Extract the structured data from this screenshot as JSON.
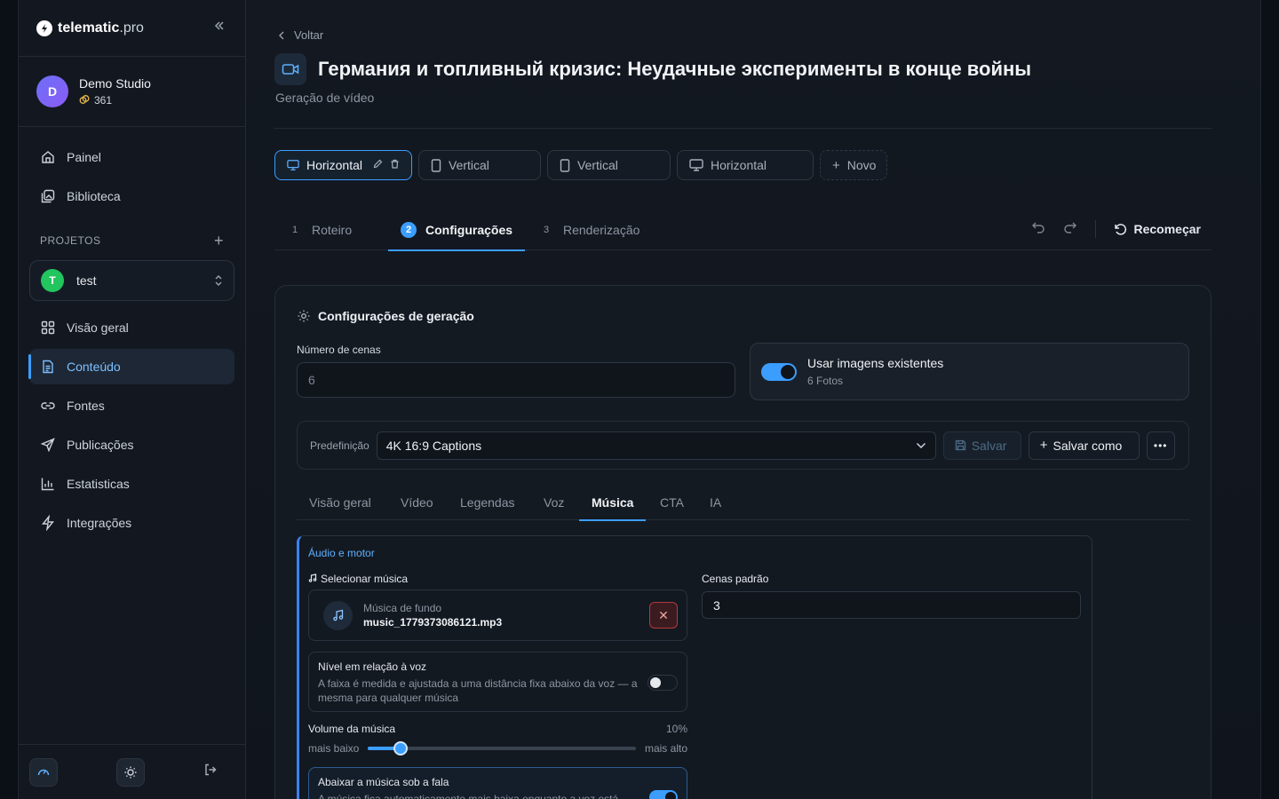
{
  "brand": {
    "name": "telematic",
    "tld": ".pro"
  },
  "studio": {
    "initial": "D",
    "name": "Demo Studio",
    "credits": "361"
  },
  "nav": {
    "painel": "Painel",
    "biblioteca": "Biblioteca"
  },
  "projects": {
    "label": "PROJETOS",
    "selected_initial": "T",
    "selected_name": "test",
    "items": [
      "Visão geral",
      "Conteúdo",
      "Fontes",
      "Publicações",
      "Estatisticas",
      "Integrações"
    ]
  },
  "header": {
    "back": "Voltar",
    "title": "Германия и топливный кризис: Неудачные эксперименты в конце войны",
    "subtitle": "Geração de vídeo"
  },
  "formats": [
    "Horizontal",
    "Vertical",
    "Vertical",
    "Horizontal"
  ],
  "formats_new": "Novo",
  "steps": [
    {
      "num": "1",
      "label": "Roteiro"
    },
    {
      "num": "2",
      "label": "Configurações"
    },
    {
      "num": "3",
      "label": "Renderização"
    }
  ],
  "restart_label": "Recomeçar",
  "card": {
    "title": "Configurações de geração",
    "scenes_label": "Número de cenas",
    "scenes_placeholder": "6",
    "use_images_title": "Usar imagens existentes",
    "use_images_sub": "6 Fotos",
    "preset_label": "Predefinição",
    "preset_value": "4K 16:9 Captions",
    "save_label": "Salvar",
    "save_as_label": "Salvar como",
    "tabs": [
      "Visão geral",
      "Vídeo",
      "Legendas",
      "Voz",
      "Música",
      "CTA",
      "IA"
    ]
  },
  "music": {
    "section": "Áudio e motor",
    "select_label": "Selecionar música",
    "bg_label": "Música de fundo",
    "file": "music_1779373086121.mp3",
    "level_title": "Nível em relação à voz",
    "level_desc": "A faixa é medida e ajustada a uma distância fixa abaixo da voz — a mesma para qualquer música",
    "volume_label": "Volume da música",
    "volume_pct": "10%",
    "volume_value": 0.12,
    "lower": "mais baixo",
    "higher": "mais alto",
    "duck_title": "Abaixar a música sob a fala",
    "duck_desc": "A música fica automaticamente mais baixa enquanto a voz está",
    "default_scenes_label": "Cenas padrão",
    "default_scenes_value": "3"
  },
  "colors": {
    "accent": "#3b9eff",
    "active_nav": "#7cc0ff",
    "danger": "#b03a3a"
  }
}
